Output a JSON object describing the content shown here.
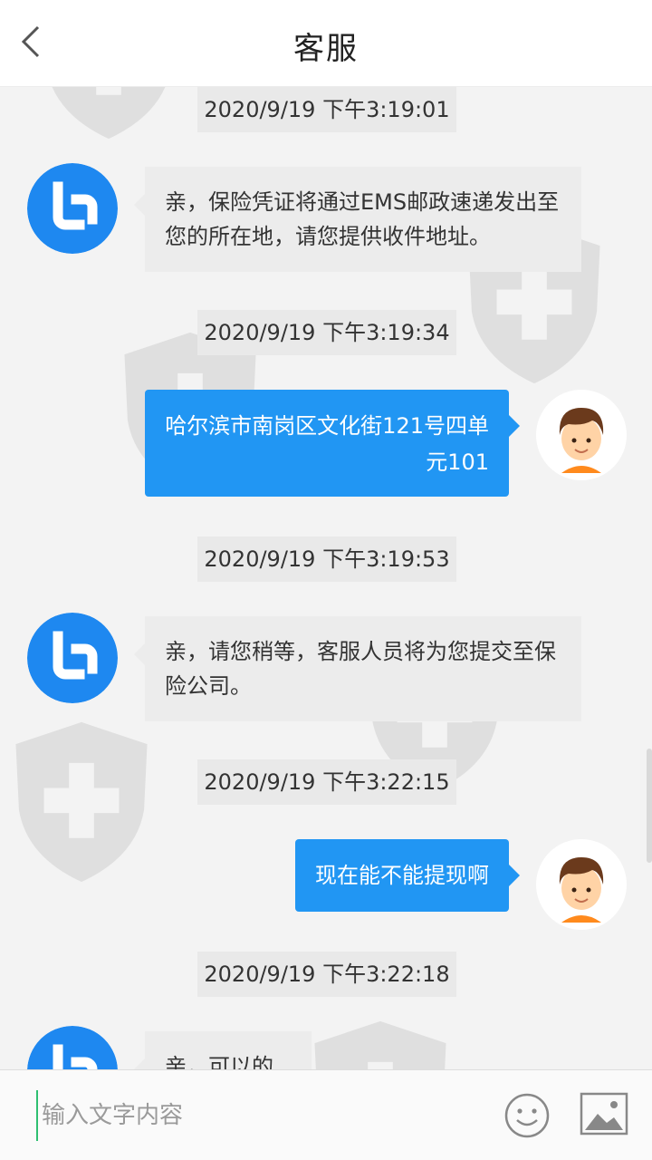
{
  "header": {
    "title": "客服"
  },
  "messages": [
    {
      "timestamp": "2020/9/19 下午3:19:01",
      "sender": "agent",
      "lines": [
        "亲，保险凭证将通过EMS邮政速递发出至",
        "您的所在地，请您提供收件地址。"
      ]
    },
    {
      "timestamp": "2020/9/19 下午3:19:34",
      "sender": "user",
      "lines": [
        "哈尔滨市南岗区文化街121号四单",
        "元101"
      ]
    },
    {
      "timestamp": "2020/9/19 下午3:19:53",
      "sender": "agent",
      "lines": [
        "亲，请您稍等，客服人员将为您提交至保",
        "险公司。"
      ]
    },
    {
      "timestamp": "2020/9/19 下午3:22:15",
      "sender": "user",
      "lines": [
        "现在能不能提现啊"
      ]
    },
    {
      "timestamp": "2020/9/19 下午3:22:18",
      "sender": "agent",
      "lines": [
        "亲，可以的"
      ]
    }
  ],
  "footer": {
    "placeholder": "输入文字内容"
  },
  "icons": {
    "back": "chevron-left-icon",
    "emoji": "smiley-icon",
    "image": "image-icon",
    "agent_avatar": "service-logo-icon",
    "user_avatar": "boy-avatar-icon"
  },
  "colors": {
    "accent": "#2196f3",
    "agent_bubble": "#ececec",
    "user_bubble": "#2196f3",
    "watermark": "#9a9a9a"
  }
}
